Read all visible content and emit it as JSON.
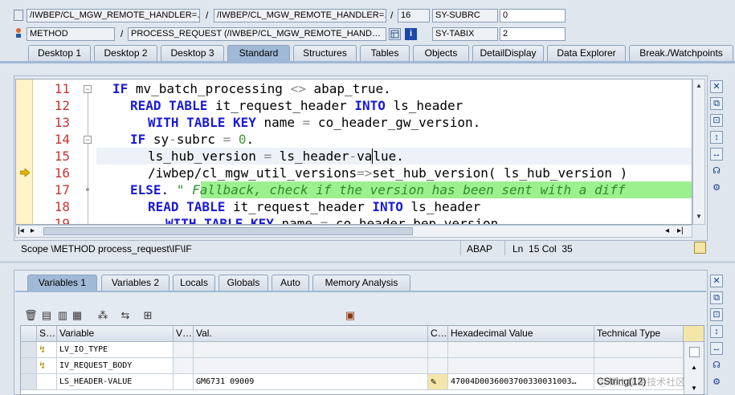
{
  "header": {
    "row1": {
      "program": "/IWBEP/CL_MGW_REMOTE_HANDLER=…",
      "include": "/IWBEP/CL_MGW_REMOTE_HANDLER=…",
      "line": "16",
      "var_name": "SY-SUBRC",
      "var_value": "0"
    },
    "row2": {
      "kind": "METHOD",
      "method": "PROCESS_REQUEST (/IWBEP/CL_MGW_REMOTE_HAND…",
      "var_name": "SY-TABIX",
      "var_value": "2"
    },
    "sep1": "/",
    "sep2": "/",
    "sep3": "/"
  },
  "tabs": [
    "Desktop 1",
    "Desktop 2",
    "Desktop 3",
    "Standard",
    "Structures",
    "Tables",
    "Objects",
    "DetailDisplay",
    "Data Explorer",
    "Break./Watchpoints"
  ],
  "active_tab": "Standard",
  "code": {
    "lines": [
      {
        "no": "11",
        "text": "IF mv_batch_processing <> abap_true."
      },
      {
        "no": "12",
        "text": "READ TABLE it_request_header INTO ls_header"
      },
      {
        "no": "13",
        "text": "WITH TABLE KEY name = co_header_gw_version."
      },
      {
        "no": "14",
        "text": "IF sy-subrc = 0."
      },
      {
        "no": "15",
        "text": "ls_hub_version = ls_header-value."
      },
      {
        "no": "16",
        "text": "/iwbep/cl_mgw_util_versions=>set_hub_version( ls_hub_version )"
      },
      {
        "no": "17",
        "text": "ELSE. \" Fallback, check if the version has been sent with a diff"
      },
      {
        "no": "18",
        "text": "READ TABLE it_request_header INTO ls_header"
      },
      {
        "no": "19",
        "text": "WITH TABLE KEY name = co_header_bep_version."
      }
    ],
    "current_line": "16"
  },
  "status": {
    "scope": "Scope \\METHOD process_request\\IF\\IF",
    "language": "ABAP",
    "position": "Ln  15 Col  35"
  },
  "var_tabs": [
    "Variables 1",
    "Variables 2",
    "Locals",
    "Globals",
    "Auto",
    "Memory Analysis"
  ],
  "active_var_tab": "Variables 1",
  "grid": {
    "headers": [
      "S…",
      "Variable",
      "V…",
      "Val.",
      "C…",
      "Hexadecimal Value",
      "Technical Type"
    ],
    "rows": [
      {
        "variable": "LV_IO_TYPE",
        "value": "",
        "hex": "",
        "type": ""
      },
      {
        "variable": "IV_REQUEST_BODY",
        "value": "",
        "hex": "",
        "type": ""
      },
      {
        "variable": "LS_HEADER-VALUE",
        "value": "GM6731 09009",
        "hex": "47004D0036003700330031003…",
        "type": "CString(12)"
      }
    ]
  },
  "colors": {
    "background": "#dfe6ee",
    "line_number": "#cc3333",
    "keyword": "#1a1ad6",
    "comment_bg": "#9df08e",
    "active_tab": "#9fb9d6"
  },
  "watermark": "@稀土掘金技术社区"
}
